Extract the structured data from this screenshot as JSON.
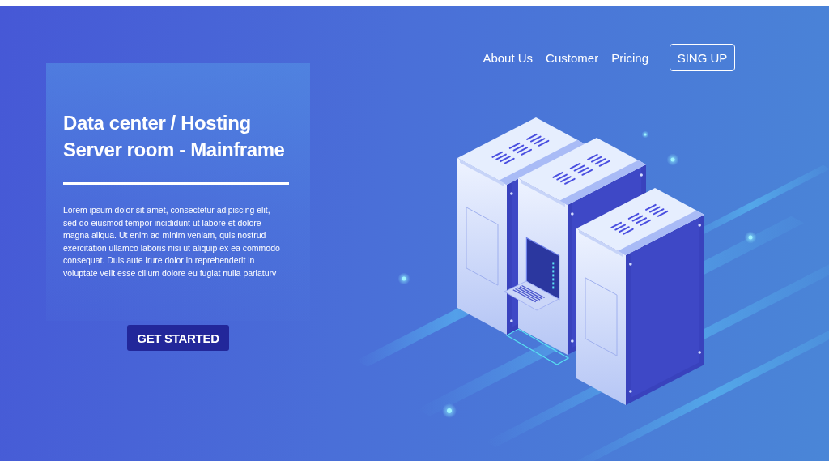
{
  "nav": {
    "links": [
      {
        "label": "About Us"
      },
      {
        "label": "Customer"
      },
      {
        "label": "Pricing"
      }
    ],
    "signup_button": "SING UP"
  },
  "hero": {
    "heading_lines": [
      "Data center / Hosting",
      "Server room - Mainframe"
    ],
    "body": "Lorem ipsum dolor sit amet, consectetur adipiscing elit, sed do eiusmod tempor incididunt ut labore et dolore magna aliqua. Ut enim ad minim veniam, quis nostrud exercitation ullamco laboris nisi ut aliquip ex ea commodo consequat. Duis aute irure dolor in reprehenderit in voluptate velit esse cillum dolore eu fugiat nulla pariaturv",
    "cta_button": "GET STARTED"
  }
}
